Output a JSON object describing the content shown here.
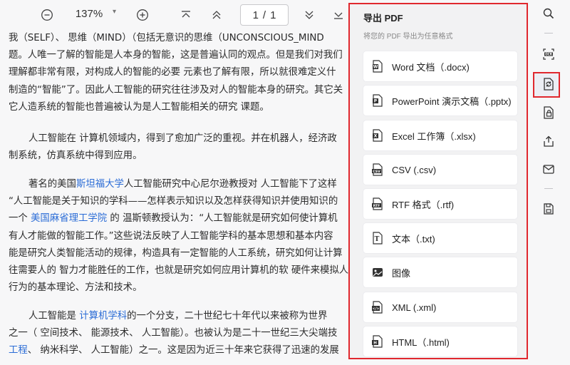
{
  "toolbar": {
    "zoom_out_icon": "minus-circle-icon",
    "zoom_value": "137%",
    "zoom_dropdown_icon": "caret-down-icon",
    "zoom_in_icon": "plus-circle-icon",
    "first_page_icon": "first-page-icon",
    "prev_page_icon": "chevron-up-icon",
    "page_current": "1",
    "page_separator": "/",
    "page_total": "1",
    "next_page_icon": "chevron-down-icon",
    "last_page_icon": "last-page-icon"
  },
  "document": {
    "p1": {
      "l1": "我（SELF）、 思维（MIND）（包括无意识的思维（UNCONSCIOUS_MIND",
      "l2": "题。人唯一了解的智能是人本身的智能，这是普遍认同的观点。但是我们对我们",
      "l3": "理解都非常有限，对构成人的智能的必要 元素也了解有限，所以就很难定义什",
      "l4": "制造的“智能”了。因此人工智能的研究往往涉及对人的智能本身的研究。其它关",
      "l5": "它人造系统的智能也普遍被认为是人工智能相关的研究 课题。"
    },
    "p2": {
      "l1": "人工智能在 计算机领域内，得到了愈加广泛的重视。并在机器人，经济政",
      "l2": "制系统，仿真系统中得到应用。"
    },
    "p3": {
      "l1a": "著名的美国",
      "l1link": "斯坦福大学",
      "l1b": "人工智能研究中心尼尔逊教授对 人工智能下了这样",
      "l2": "“人工智能是关于知识的学科——怎样表示知识以及怎样获得知识并使用知识的",
      "l3a": "一个 ",
      "l3link": "美国麻省理工学院",
      "l3b": " 的 温斯顿教授认为：“人工智能就是研究如何使计算机",
      "l4": "有人才能做的智能工作。”这些说法反映了人工智能学科的基本思想和基本内容",
      "l5": "能是研究人类智能活动的规律，构造具有一定智能的人工系统，研究如何让计算",
      "l6": "往需要人的 智力才能胜任的工作，也就是研究如何应用计算机的软 硬件来模拟人",
      "l7": "行为的基本理论、方法和技术。"
    },
    "p4": {
      "l1a": "人工智能是 ",
      "l1link": "计算机学科",
      "l1b": "的一个分支，二十世纪七十年代以来被称为世界",
      "l2": "之一（ 空间技术、 能源技术、 人工智能）。也被认为是二十一世纪三大尖端技",
      "l3link": "工程",
      "l3b": "、 纳米科学、 人工智能）之一。这是因为近三十年来它获得了迅速的发展"
    }
  },
  "export_panel": {
    "title": "导出 PDF",
    "subtitle": "将您的 PDF 导出为任意格式",
    "options": [
      {
        "label": "Word 文档（.docx)",
        "icon": "word-file-icon"
      },
      {
        "label": "PowerPoint 演示文稿（.pptx)",
        "icon": "powerpoint-file-icon"
      },
      {
        "label": "Excel 工作簿（.xlsx)",
        "icon": "excel-file-icon"
      },
      {
        "label": "CSV (.csv)",
        "icon": "csv-file-icon"
      },
      {
        "label": "RTF 格式（.rtf)",
        "icon": "rtf-file-icon"
      },
      {
        "label": "文本（.txt)",
        "icon": "text-file-icon"
      },
      {
        "label": "图像",
        "icon": "image-icon"
      },
      {
        "label": "XML (.xml)",
        "icon": "xml-file-icon"
      },
      {
        "label": "HTML（.html)",
        "icon": "html-file-icon"
      }
    ]
  },
  "sidebar": {
    "icons": [
      "search-icon",
      "ocr-icon",
      "convert-icon",
      "protect-icon",
      "share-icon",
      "email-icon",
      "save-icon"
    ],
    "ocr_label": "OCR"
  },
  "colors": {
    "highlight_border": "#e0282e",
    "link": "#2b6cd6",
    "panel_bg": "#f2f2f3"
  }
}
